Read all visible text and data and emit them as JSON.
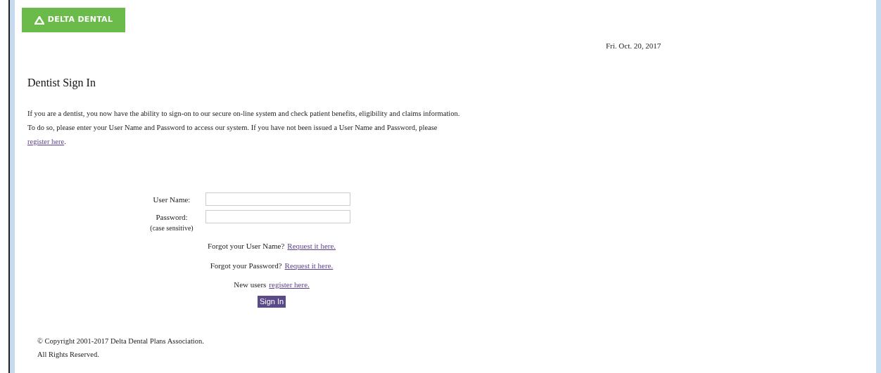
{
  "logo": {
    "text": "DELTA DENTAL"
  },
  "date": "Fri. Oct. 20, 2017",
  "heading": "Dentist Sign In",
  "intro": {
    "text": "If you are a dentist, you now have the ability to sign-on to our secure on-line system and check patient benefits, eligibility and claims information. To do so, please enter your User Name and Password to access our system. If you have not been issued a User Name and Password, please",
    "link": "register here",
    "end": "."
  },
  "fields": [
    {
      "label": "User Name:"
    },
    {
      "label": "Password:",
      "note": "(case sensitive)"
    }
  ],
  "help_lines": [
    {
      "text": "Forgot your User Name?",
      "link": "Request it here."
    },
    {
      "text": "Forgot your Password?",
      "link": "Request it here."
    },
    {
      "text": "New users",
      "link": "register here."
    }
  ],
  "sign_in_button": "Sign In",
  "footer": [
    "© Copyright 2001-2017 Delta Dental Plans Association.",
    "All Rights Reserved."
  ]
}
